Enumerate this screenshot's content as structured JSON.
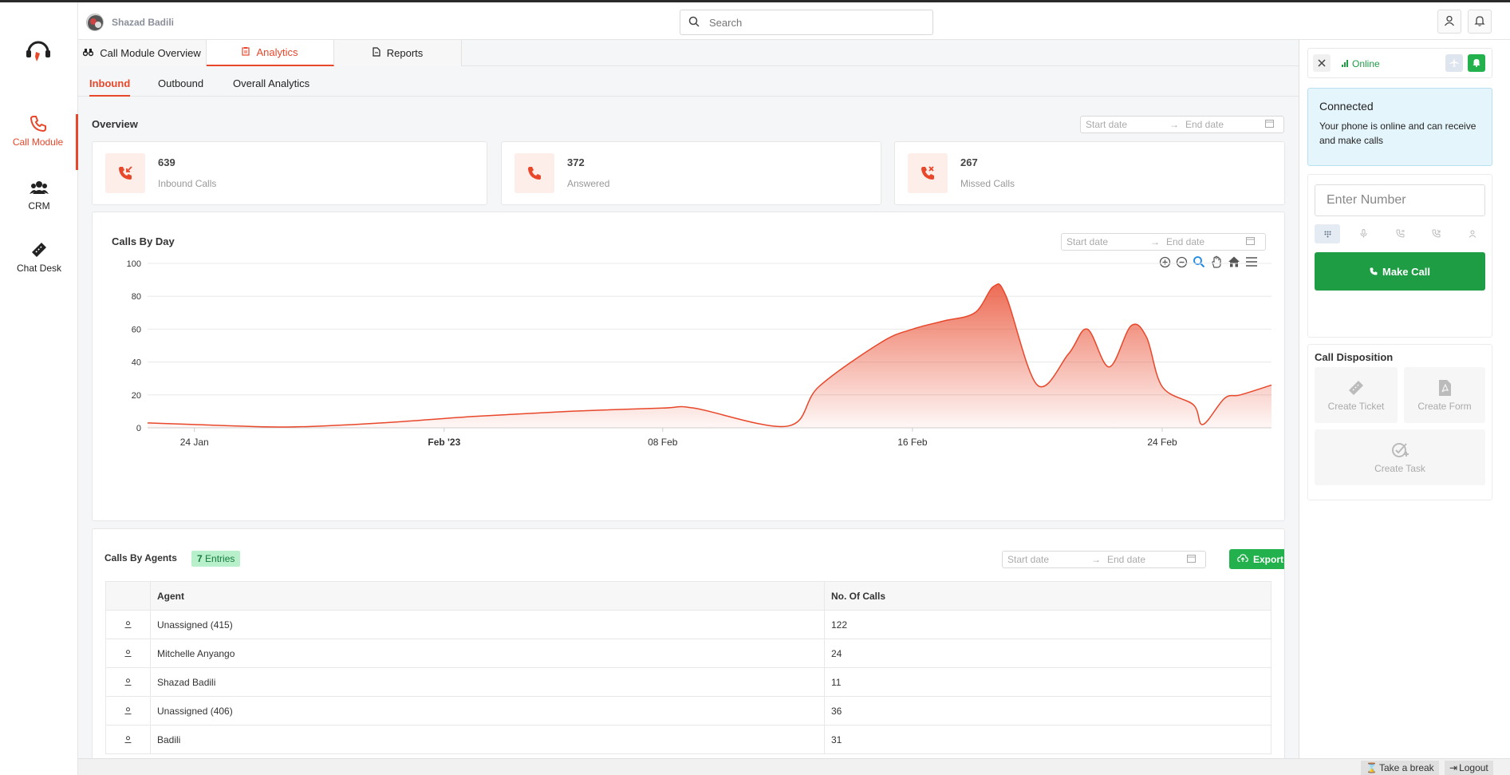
{
  "nav": {
    "items": [
      {
        "label": "Call Module",
        "icon": "phone-icon"
      },
      {
        "label": "CRM",
        "icon": "users-icon"
      },
      {
        "label": "Chat Desk",
        "icon": "ticket-icon"
      }
    ]
  },
  "header": {
    "user_name": "Shazad Badili",
    "search_placeholder": "Search"
  },
  "tabs": [
    {
      "label": "Call Module Overview",
      "icon": "binoculars-icon"
    },
    {
      "label": "Analytics",
      "icon": "clipboard-icon"
    },
    {
      "label": "Reports",
      "icon": "file-icon"
    }
  ],
  "subtabs": [
    "Inbound",
    "Outbound",
    "Overall Analytics"
  ],
  "overview": {
    "title": "Overview",
    "date_start": "Start date",
    "date_end": "End date",
    "stats": [
      {
        "value": "639",
        "label": "Inbound Calls",
        "icon": "incoming-call-icon"
      },
      {
        "value": "372",
        "label": "Answered",
        "icon": "phone-icon"
      },
      {
        "value": "267",
        "label": "Missed Calls",
        "icon": "missed-call-icon"
      }
    ]
  },
  "chart_section": {
    "title": "Calls By Day",
    "date_start": "Start date",
    "date_end": "End date"
  },
  "chart_data": {
    "type": "area",
    "title": "Calls By Day",
    "xlabel": "",
    "ylabel": "",
    "ylim": [
      0,
      100
    ],
    "yticks": [
      0,
      20,
      40,
      60,
      80,
      100
    ],
    "xticks": [
      "24 Jan",
      "Feb '23",
      "08 Feb",
      "16 Feb",
      "24 Feb"
    ],
    "xrange_days": [
      -1.5,
      34.5
    ],
    "xtick_days": [
      0,
      8,
      15,
      23,
      31
    ],
    "series": [
      {
        "days": [
          -1.5,
          0,
          3,
          6,
          9,
          12,
          15,
          16,
          19,
          20,
          22,
          23,
          24,
          25,
          25.6,
          26,
          27,
          28,
          28.6,
          29.3,
          30,
          30.5,
          31,
          32,
          32.3,
          33,
          33.5,
          34.5
        ],
        "values": [
          3,
          2,
          0.5,
          3,
          7,
          10,
          12,
          12,
          1,
          25,
          52,
          60,
          65,
          70,
          86,
          80,
          26,
          45,
          60,
          37,
          62,
          55,
          25,
          14,
          2,
          18,
          20,
          26
        ]
      }
    ],
    "color": "#e8472a",
    "grid": true
  },
  "agents": {
    "title": "Calls By Agents",
    "entries_count": "7",
    "entries_label": "Entries",
    "date_start": "Start date",
    "date_end": "End date",
    "export_label": "Export",
    "columns": [
      "",
      "Agent",
      "No. Of Calls"
    ],
    "rows": [
      {
        "agent": "Unassigned (415)",
        "calls": "122"
      },
      {
        "agent": "Mitchelle Anyango",
        "calls": "24"
      },
      {
        "agent": "Shazad Badili",
        "calls": "11"
      },
      {
        "agent": "Unassigned (406)",
        "calls": "36"
      },
      {
        "agent": "Badili",
        "calls": "31"
      }
    ]
  },
  "phone": {
    "status": "Online",
    "connected_title": "Connected",
    "connected_desc": "Your phone is online and can receive and make calls",
    "number_placeholder": "Enter Number",
    "make_call_label": "Make Call",
    "disposition_title": "Call Disposition",
    "disposition_actions": [
      "Create Ticket",
      "Create Form",
      "Create Task"
    ]
  },
  "footer": {
    "break_label": "Take a break",
    "logout_label": "Logout"
  },
  "colors": {
    "accent": "#e8472a",
    "success": "#1f9d45",
    "connected_bg": "#e5f5fc"
  }
}
